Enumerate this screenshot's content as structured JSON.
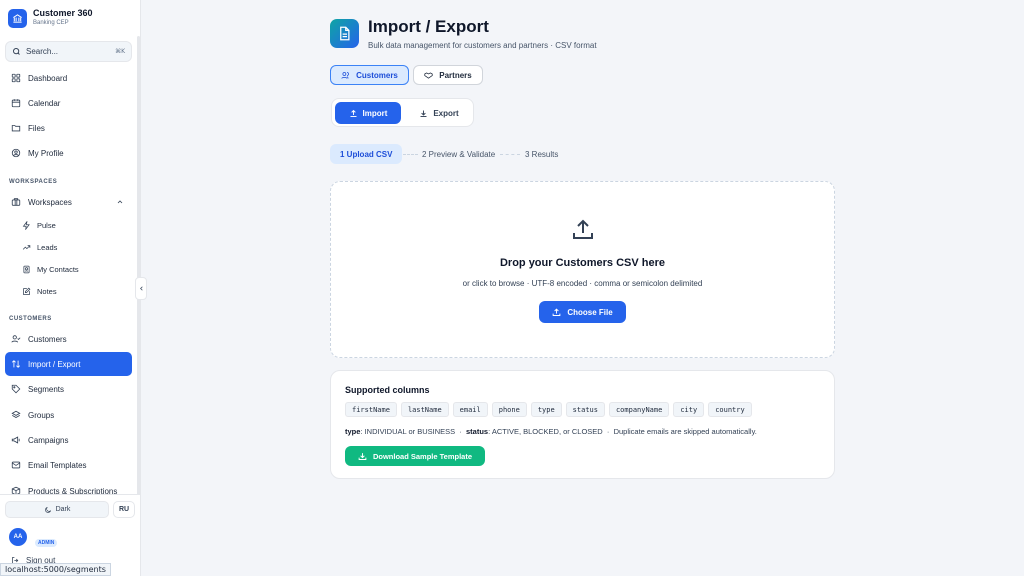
{
  "brand": {
    "title": "Customer 360",
    "subtitle": "Banking CEP"
  },
  "search": {
    "placeholder": "Search...",
    "shortcut": "⌘K"
  },
  "nav": {
    "main": [
      {
        "label": "Dashboard",
        "icon": "grid-icon"
      },
      {
        "label": "Calendar",
        "icon": "calendar-icon"
      },
      {
        "label": "Files",
        "icon": "folder-icon"
      },
      {
        "label": "My Profile",
        "icon": "user-circle-icon"
      }
    ],
    "workspaces_section": "WORKSPACES",
    "workspaces_group": "Workspaces",
    "workspaces_items": [
      {
        "label": "Pulse",
        "icon": "sparkle-icon"
      },
      {
        "label": "Leads",
        "icon": "trend-icon"
      },
      {
        "label": "My Contacts",
        "icon": "contact-book-icon"
      },
      {
        "label": "Notes",
        "icon": "edit-note-icon"
      }
    ],
    "customers_section": "CUSTOMERS",
    "customers_items": [
      {
        "label": "Customers",
        "icon": "user-check-icon"
      },
      {
        "label": "Import / Export",
        "icon": "arrows-up-down-icon",
        "active": true
      },
      {
        "label": "Segments",
        "icon": "tag-icon"
      },
      {
        "label": "Groups",
        "icon": "layers-icon"
      },
      {
        "label": "Campaigns",
        "icon": "megaphone-icon"
      },
      {
        "label": "Email Templates",
        "icon": "mail-icon"
      },
      {
        "label": "Products & Subscriptions",
        "icon": "box-icon"
      }
    ]
  },
  "footer": {
    "theme_label": "Dark",
    "lang_label": "RU",
    "avatar_initials": "AA",
    "role": "ADMIN",
    "signout_label": "Sign out"
  },
  "status_url": "localhost:5000/segments",
  "page": {
    "title": "Import / Export",
    "subtitle": "Bulk data management for customers and partners · CSV format"
  },
  "entity_tabs": {
    "customers": "Customers",
    "partners": "Partners",
    "selected": "Customers"
  },
  "mode_tabs": {
    "import": "Import",
    "export": "Export",
    "selected": "Import"
  },
  "steps": [
    "1 Upload CSV",
    "2 Preview & Validate",
    "3 Results"
  ],
  "active_step": 1,
  "dropzone": {
    "title": "Drop your Customers CSV here",
    "subtitle": "or click to browse · UTF-8 encoded · comma or semicolon delimited",
    "button": "Choose File"
  },
  "supported": {
    "title": "Supported columns",
    "columns": [
      "firstName",
      "lastName",
      "email",
      "phone",
      "type",
      "status",
      "companyName",
      "city",
      "country"
    ],
    "type_label": "type",
    "type_text": ": INDIVIDUAL or BUSINESS",
    "status_label": "status",
    "status_text": ": ACTIVE, BLOCKED, or CLOSED",
    "sep": "·",
    "dup_text": "Duplicate emails are skipped automatically.",
    "download_button": "Download Sample Template"
  },
  "colors": {
    "primary": "#2563eb",
    "success": "#10b981",
    "accent_bg": "#dbeafe"
  }
}
